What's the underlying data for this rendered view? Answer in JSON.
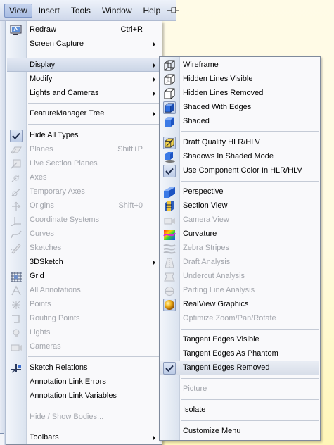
{
  "menubar": {
    "items": [
      {
        "label": "View",
        "active": true
      },
      {
        "label": "Insert"
      },
      {
        "label": "Tools"
      },
      {
        "label": "Window"
      },
      {
        "label": "Help"
      }
    ]
  },
  "view_menu": {
    "items": [
      {
        "label": "Redraw",
        "shortcut": "Ctrl+R",
        "icon": "redraw-icon"
      },
      {
        "label": "Screen Capture",
        "submenu": true
      },
      {
        "label": "Display",
        "submenu": true,
        "highlighted": true
      },
      {
        "label": "Modify",
        "submenu": true
      },
      {
        "label": "Lights and Cameras",
        "submenu": true
      },
      {
        "label": "FeatureManager Tree",
        "submenu": true
      },
      {
        "label": "Hide All Types",
        "checked": true
      },
      {
        "label": "Planes",
        "shortcut": "Shift+P",
        "disabled": true,
        "icon": "planes-icon"
      },
      {
        "label": "Live Section Planes",
        "disabled": true,
        "icon": "live-section-planes-icon"
      },
      {
        "label": "Axes",
        "disabled": true,
        "icon": "axes-icon"
      },
      {
        "label": "Temporary Axes",
        "disabled": true,
        "icon": "temporary-axes-icon"
      },
      {
        "label": "Origins",
        "shortcut": "Shift+0",
        "disabled": true,
        "icon": "origins-icon"
      },
      {
        "label": "Coordinate Systems",
        "disabled": true,
        "icon": "coordinate-systems-icon"
      },
      {
        "label": "Curves",
        "disabled": true,
        "icon": "curves-icon"
      },
      {
        "label": "Sketches",
        "disabled": true,
        "icon": "sketches-icon"
      },
      {
        "label": "3DSketch",
        "submenu": true
      },
      {
        "label": "Grid",
        "icon": "grid-icon"
      },
      {
        "label": "All Annotations",
        "disabled": true,
        "icon": "all-annotations-icon"
      },
      {
        "label": "Points",
        "disabled": true,
        "icon": "points-icon"
      },
      {
        "label": "Routing Points",
        "disabled": true,
        "icon": "routing-points-icon"
      },
      {
        "label": "Lights",
        "disabled": true,
        "icon": "lights-icon"
      },
      {
        "label": "Cameras",
        "disabled": true,
        "icon": "cameras-icon"
      },
      {
        "label": "Sketch Relations",
        "icon": "sketch-relations-icon"
      },
      {
        "label": "Annotation Link Errors"
      },
      {
        "label": "Annotation Link Variables"
      },
      {
        "label": "Hide / Show Bodies...",
        "disabled": true
      },
      {
        "label": "Toolbars",
        "submenu": true
      }
    ]
  },
  "display_menu": {
    "items": [
      {
        "label": "Wireframe",
        "icon": "wireframe-icon"
      },
      {
        "label": "Hidden Lines Visible",
        "icon": "hidden-lines-visible-icon"
      },
      {
        "label": "Hidden Lines Removed",
        "icon": "hidden-lines-removed-icon"
      },
      {
        "label": "Shaded With Edges",
        "icon": "shaded-with-edges-icon",
        "checked": true
      },
      {
        "label": "Shaded",
        "icon": "shaded-icon"
      },
      {
        "label": "Draft Quality HLR/HLV",
        "icon": "draft-quality-icon",
        "checked": true
      },
      {
        "label": "Shadows In Shaded Mode",
        "icon": "shadows-icon"
      },
      {
        "label": "Use Component Color In HLR/HLV",
        "checked": true
      },
      {
        "label": "Perspective",
        "icon": "perspective-icon"
      },
      {
        "label": "Section View",
        "icon": "section-view-icon"
      },
      {
        "label": "Camera View",
        "disabled": true,
        "icon": "camera-view-icon"
      },
      {
        "label": "Curvature",
        "icon": "curvature-icon"
      },
      {
        "label": "Zebra Stripes",
        "disabled": true,
        "icon": "zebra-stripes-icon"
      },
      {
        "label": "Draft Analysis",
        "disabled": true,
        "icon": "draft-analysis-icon"
      },
      {
        "label": "Undercut Analysis",
        "disabled": true,
        "icon": "undercut-analysis-icon"
      },
      {
        "label": "Parting Line Analysis",
        "disabled": true,
        "icon": "parting-line-analysis-icon"
      },
      {
        "label": "RealView Graphics",
        "icon": "realview-graphics-icon",
        "checked": true
      },
      {
        "label": "Optimize Zoom/Pan/Rotate",
        "disabled": true
      },
      {
        "label": "Tangent Edges Visible"
      },
      {
        "label": "Tangent Edges As Phantom"
      },
      {
        "label": "Tangent Edges Removed",
        "checked": true
      },
      {
        "label": "Picture",
        "disabled": true
      },
      {
        "label": "Isolate"
      },
      {
        "label": "Customize Menu"
      }
    ]
  },
  "colors": {
    "accent": "#3b6fd6",
    "disabled_text": "#a3a6ad",
    "menubar": "#dbe3f1"
  }
}
